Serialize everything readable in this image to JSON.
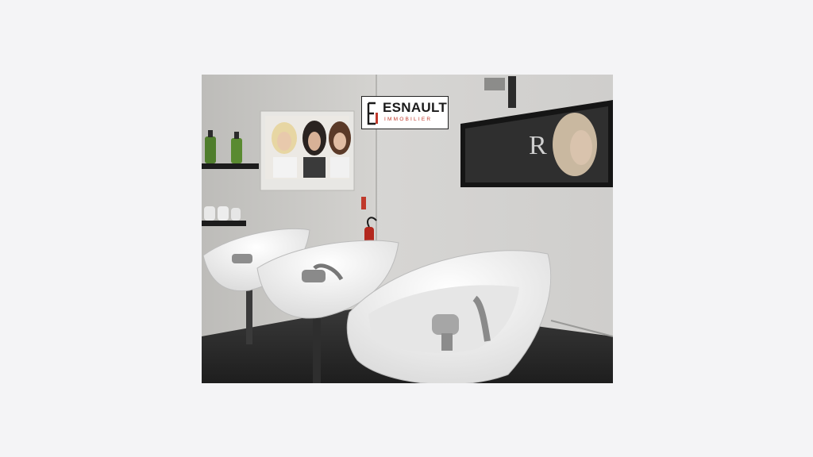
{
  "page": {
    "background": "#f4f4f6"
  },
  "photo": {
    "subject": "hair salon shampoo basins",
    "colors": {
      "wall": "#d9d8d6",
      "shadow": "#2a2a2a",
      "basin": "#f2f2f2",
      "accent": "#c0392b"
    }
  },
  "logo": {
    "name": "ESNAULT",
    "subtitle": "IMMOBILIER",
    "mark_icon": "ei-monogram-icon"
  }
}
